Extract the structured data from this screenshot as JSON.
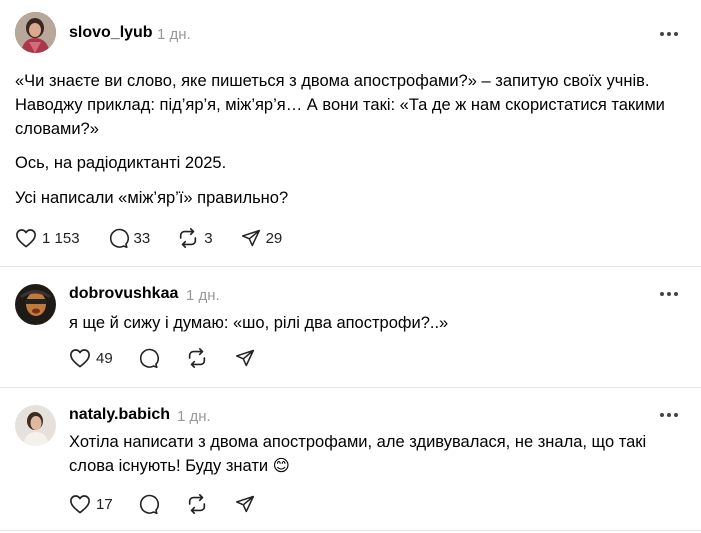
{
  "post": {
    "username": "slovo_lyub",
    "time": "1 дн.",
    "paragraphs": [
      "«Чи знаєте ви слово, яке пишеться з двома апострофами?» – запитую своїх учнів. Наводжу приклад: під’яр’я, між’яр’я… А вони такі: «Та де ж нам скористатися такими словами?»",
      "Ось, на радіодиктанті 2025.",
      "Усі написали «між’яр’ї» правильно?"
    ],
    "likes": "1 153",
    "comments": "33",
    "reposts": "3",
    "shares": "29"
  },
  "replies": [
    {
      "username": "dobrovushkaa",
      "time": "1 дн.",
      "text": "я ще й сижу і думаю: «шо, рілі два апострофи?..»",
      "likes": "49"
    },
    {
      "username": "nataly.babich",
      "time": "1 дн.",
      "text": "Хотіла написати з двома апострофами, але здивувалася, не знала, що такі слова існують! Буду знати 😊",
      "likes": "17"
    }
  ],
  "icons": {
    "like": "heart-icon",
    "comment": "comment-bubble-icon",
    "repost": "repost-icon",
    "share": "send-icon",
    "more": "more-dots-icon"
  }
}
